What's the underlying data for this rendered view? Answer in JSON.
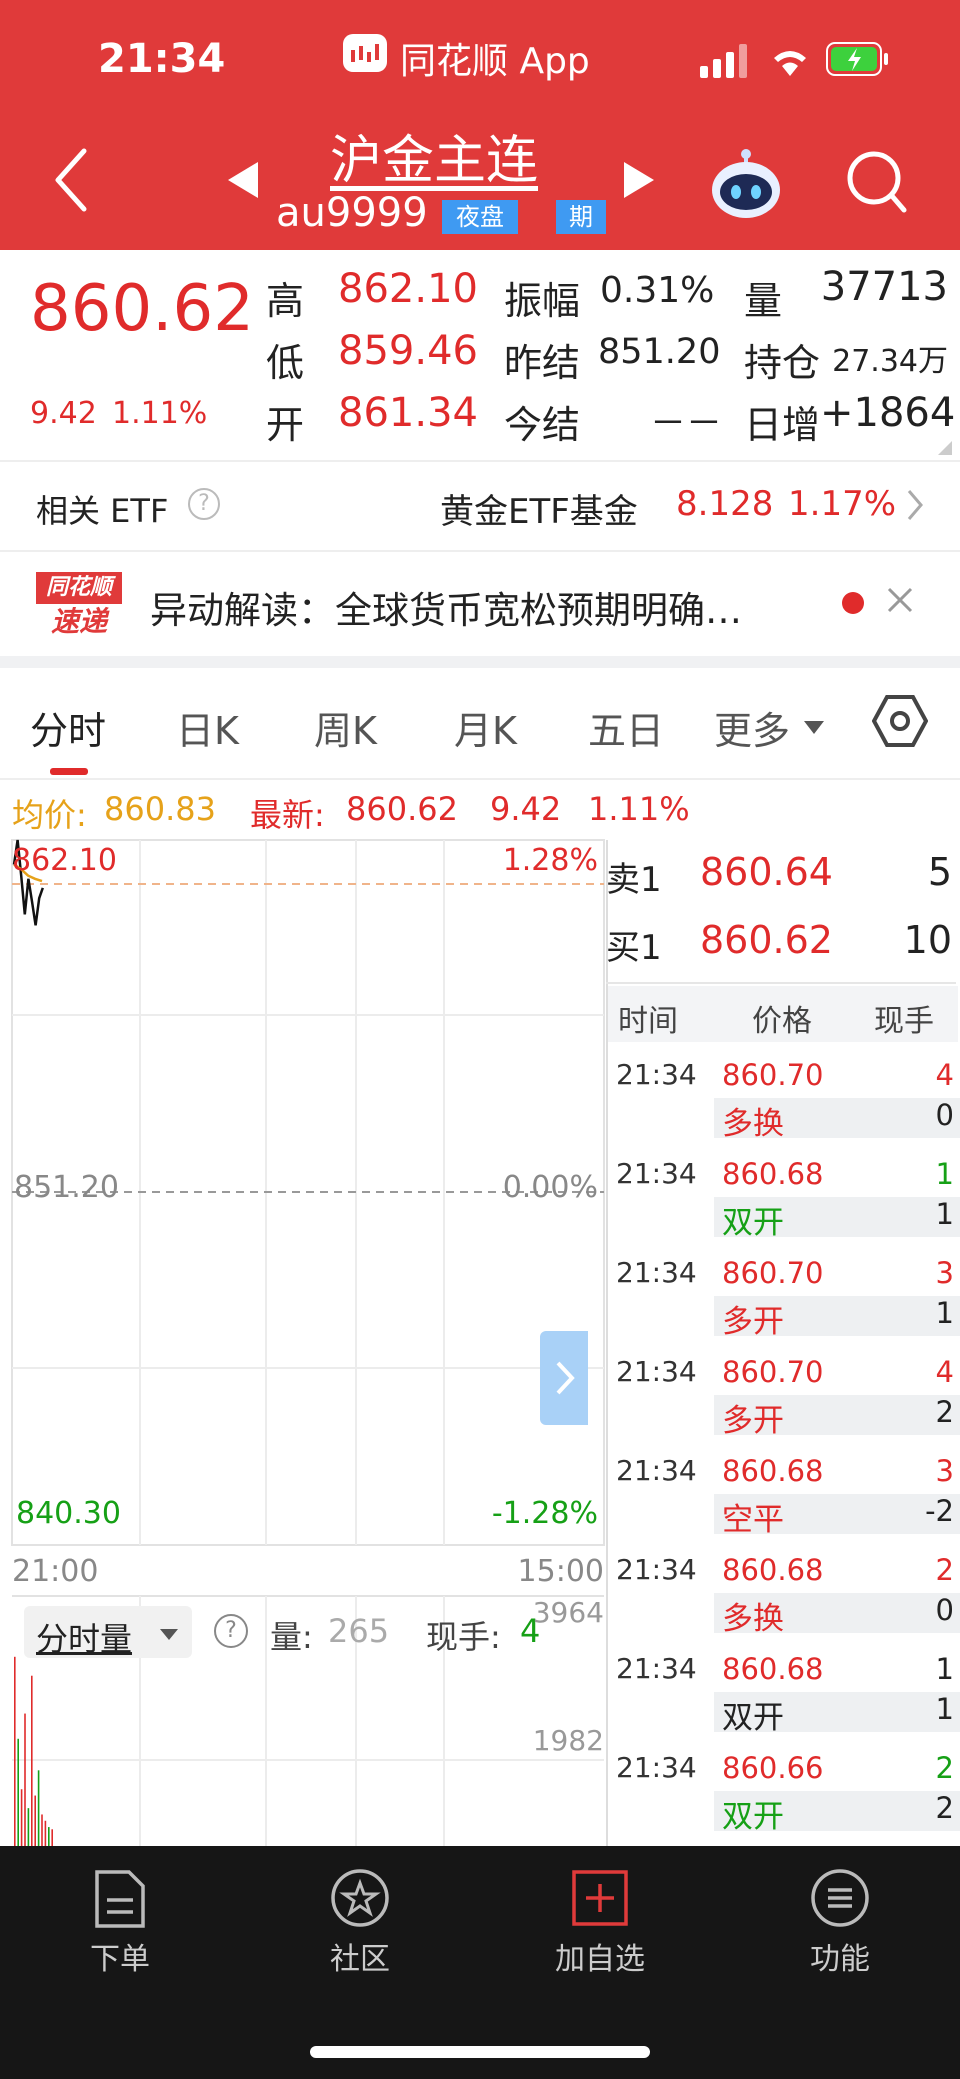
{
  "status_bar": {
    "time": "21:34",
    "app_name": "同花顺 App"
  },
  "header": {
    "title": "沪金主连",
    "code": "au9999",
    "badge_night": "夜盘",
    "badge_futures": "期"
  },
  "quote": {
    "price": "860.62",
    "change": "9.42",
    "change_pct": "1.11%",
    "stats": [
      {
        "label": "高",
        "value": "862.10"
      },
      {
        "label": "低",
        "value": "859.46"
      },
      {
        "label": "开",
        "value": "861.34"
      },
      {
        "label": "振幅",
        "value": "0.31%"
      },
      {
        "label": "昨结",
        "value": "851.20"
      },
      {
        "label": "今结",
        "value": "－－"
      },
      {
        "label": "量",
        "value": "37713"
      },
      {
        "label": "持仓",
        "value": "27.34万"
      },
      {
        "label": "日增",
        "value": "+1864"
      }
    ]
  },
  "etf": {
    "label": "相关 ETF",
    "fund_name": "黄金ETF基金",
    "fund_price": "8.128",
    "fund_pct": "1.17%"
  },
  "news": {
    "logo_top": "同花顺",
    "logo_bottom": "速递",
    "text": "异动解读：全球货币宽松预期明确…"
  },
  "tabs": [
    "分时",
    "日K",
    "周K",
    "月K",
    "五日",
    "更多"
  ],
  "chart_info": {
    "avg_label": "均价:",
    "avg_value": "860.83",
    "latest_label": "最新:",
    "latest_value": "860.62",
    "change": "9.42",
    "change_pct": "1.11%"
  },
  "chart_data": {
    "type": "line",
    "y_labels": {
      "top": "862.10",
      "mid": "851.20",
      "bottom": "840.30"
    },
    "pct_labels": {
      "top": "1.28%",
      "mid": "0.00%",
      "bottom": "-1.28%"
    },
    "x_labels": {
      "start": "21:00",
      "end": "15:00"
    },
    "ylim": [
      840.3,
      862.1
    ],
    "price": [
      861.34,
      862.1,
      861.0,
      859.8,
      860.9,
      860.2,
      859.46,
      860.3,
      860.62
    ],
    "avg": [
      861.34,
      861.2,
      861.0,
      860.9,
      860.83
    ],
    "volume_axis": {
      "top": "3964",
      "mid": "1982"
    },
    "volume": [
      3000,
      1700,
      900,
      2100,
      600,
      2700,
      800,
      1200,
      500,
      400,
      300,
      265
    ]
  },
  "volume_panel": {
    "selector": "分时量",
    "vol_label": "量:",
    "vol_value": "265",
    "hand_label": "现手:",
    "hand_value": "4"
  },
  "order_book": {
    "sell": {
      "label": "卖1",
      "price": "860.64",
      "vol": "5"
    },
    "buy": {
      "label": "买1",
      "price": "860.62",
      "vol": "10"
    },
    "headers": [
      "时间",
      "价格",
      "现手"
    ]
  },
  "trades": [
    {
      "time": "21:34",
      "price": "860.70",
      "vol": "4",
      "type": "多换",
      "type_vol": "0"
    },
    {
      "time": "21:34",
      "price": "860.68",
      "vol": "1",
      "type": "双开",
      "type_vol": "1"
    },
    {
      "time": "21:34",
      "price": "860.70",
      "vol": "3",
      "type": "多开",
      "type_vol": "1"
    },
    {
      "time": "21:34",
      "price": "860.70",
      "vol": "4",
      "type": "多开",
      "type_vol": "2"
    },
    {
      "time": "21:34",
      "price": "860.68",
      "vol": "3",
      "type": "空平",
      "type_vol": "-2"
    },
    {
      "time": "21:34",
      "price": "860.68",
      "vol": "2",
      "type": "多换",
      "type_vol": "0"
    },
    {
      "time": "21:34",
      "price": "860.68",
      "vol": "1",
      "type": "双开",
      "type_vol": "1"
    },
    {
      "time": "21:34",
      "price": "860.66",
      "vol": "2",
      "type": "双开",
      "type_vol": "2"
    }
  ],
  "bottom_nav": [
    "下单",
    "社区",
    "加自选",
    "功能"
  ],
  "colors": {
    "header": "#e03a3a",
    "up": "#e02b2b",
    "down": "#16a016",
    "avg": "#e6a21a",
    "nav": "#161616"
  }
}
